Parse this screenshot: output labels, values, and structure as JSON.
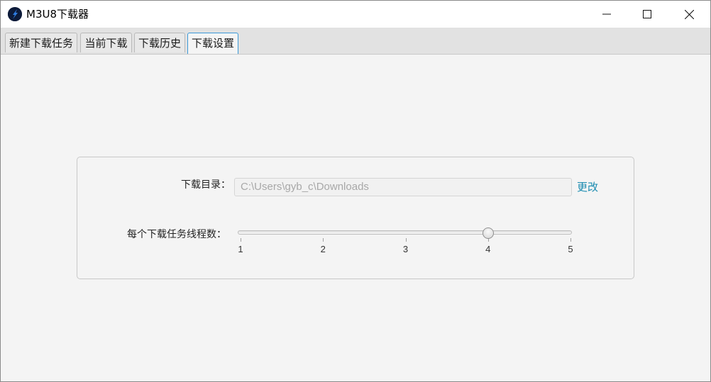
{
  "window": {
    "title": "M3U8下载器"
  },
  "tabs": [
    {
      "label": "新建下载任务"
    },
    {
      "label": "当前下载"
    },
    {
      "label": "下载历史"
    },
    {
      "label": "下载设置",
      "selected": true
    }
  ],
  "settings": {
    "directory_label": "下载目录：",
    "directory_value": "C:\\Users\\gyb_c\\Downloads",
    "change_label": "更改",
    "threads_label": "每个下载任务线程数：",
    "threads_slider": {
      "min": 1,
      "max": 5,
      "value": 4,
      "ticks": [
        "1",
        "2",
        "3",
        "4",
        "5"
      ]
    }
  },
  "colors": {
    "accent": "#1a8bb0",
    "tab_focus": "#3b99d8"
  }
}
